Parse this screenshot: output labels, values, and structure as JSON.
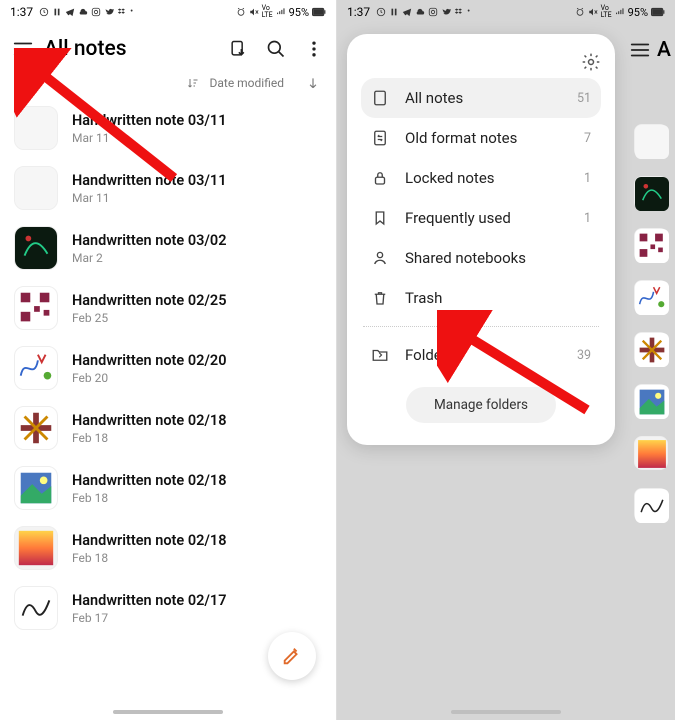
{
  "status": {
    "time": "1:37",
    "battery": "95%",
    "lte_label": "VoLTE",
    "indicators": [
      "pause",
      "telegram",
      "cloud",
      "instagram",
      "twitter",
      "dropbox",
      "dot"
    ]
  },
  "left_screen": {
    "header": {
      "title": "All notes"
    },
    "sort": {
      "label": "Date modified"
    },
    "notes": [
      {
        "title": "Handwritten note 03/11",
        "date": "Mar 11",
        "thumb": "blank"
      },
      {
        "title": "Handwritten note 03/11",
        "date": "Mar 11",
        "thumb": "blank"
      },
      {
        "title": "Handwritten note 03/02",
        "date": "Mar 2",
        "thumb": "dark"
      },
      {
        "title": "Handwritten note 02/25",
        "date": "Feb 25",
        "thumb": "qr"
      },
      {
        "title": "Handwritten note 02/20",
        "date": "Feb 20",
        "thumb": "doodle"
      },
      {
        "title": "Handwritten note 02/18",
        "date": "Feb 18",
        "thumb": "cross"
      },
      {
        "title": "Handwritten note 02/18",
        "date": "Feb 18",
        "thumb": "photo"
      },
      {
        "title": "Handwritten note 02/18",
        "date": "Feb 18",
        "thumb": "grad"
      },
      {
        "title": "Handwritten note 02/17",
        "date": "Feb 17",
        "thumb": "sketch"
      }
    ]
  },
  "right_screen": {
    "drawer": {
      "categories": [
        {
          "icon": "page",
          "label": "All notes",
          "count": "51",
          "active": true
        },
        {
          "icon": "convert",
          "label": "Old format notes",
          "count": "7",
          "active": false
        },
        {
          "icon": "lock",
          "label": "Locked notes",
          "count": "1",
          "active": false
        },
        {
          "icon": "bookmark",
          "label": "Frequently used",
          "count": "1",
          "active": false
        },
        {
          "icon": "person",
          "label": "Shared notebooks",
          "count": "",
          "active": false
        },
        {
          "icon": "trash",
          "label": "Trash",
          "count": "",
          "active": false
        }
      ],
      "folders": {
        "label": "Folders",
        "count": "39"
      },
      "manage_button": "Manage folders"
    },
    "peek_header": {
      "title": "A"
    },
    "peek_thumbs": [
      "blank",
      "dark",
      "qr",
      "doodle",
      "cross",
      "photo",
      "grad",
      "sketch"
    ]
  }
}
